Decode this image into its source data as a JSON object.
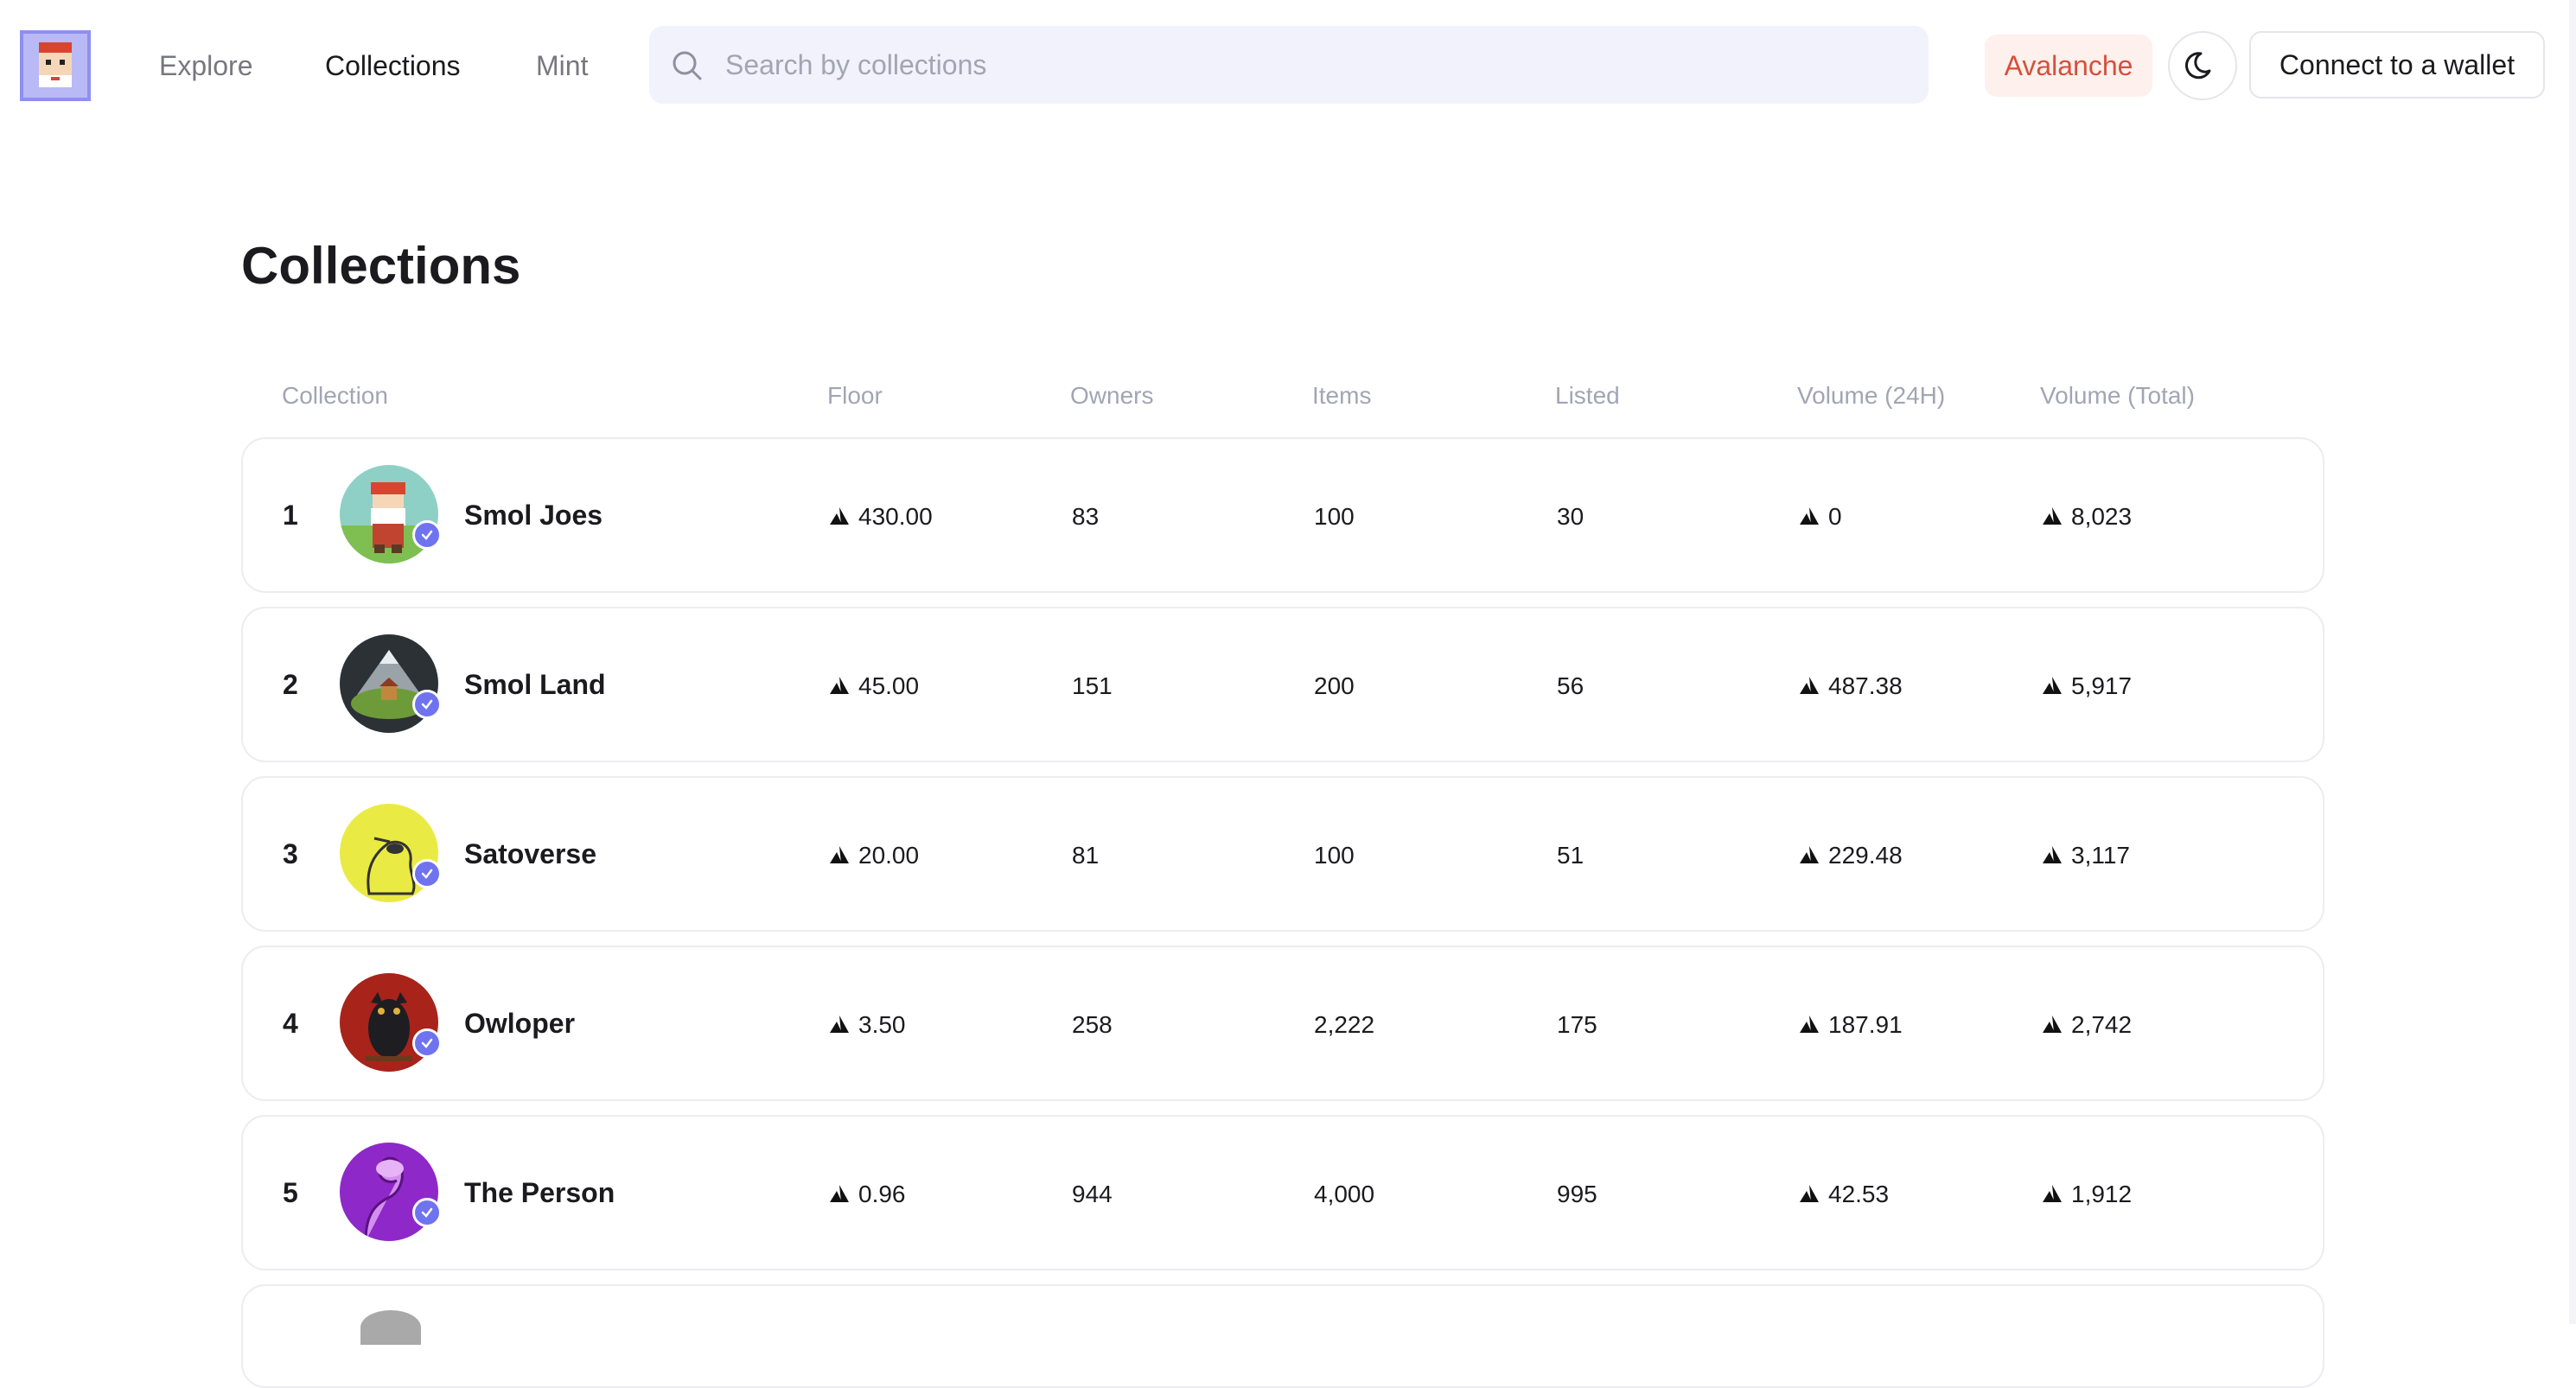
{
  "header": {
    "nav": [
      {
        "label": "Explore",
        "active": false
      },
      {
        "label": "Collections",
        "active": true
      },
      {
        "label": "Mint",
        "active": false
      }
    ],
    "search_placeholder": "Search by collections",
    "chain_label": "Avalanche",
    "connect_label": "Connect to a wallet",
    "icons": {
      "search": "search-icon",
      "theme": "moon-icon",
      "currency": "avax-icon",
      "verified": "verified-check-icon"
    },
    "colors": {
      "accent": "#6f73f0",
      "chain": "#d5503b"
    }
  },
  "page_title": "Collections",
  "table": {
    "columns": [
      "Collection",
      "Floor",
      "Owners",
      "Items",
      "Listed",
      "Volume (24H)",
      "Volume (Total)"
    ],
    "rows": [
      {
        "rank": "1",
        "name": "Smol Joes",
        "floor": "430.00",
        "owners": "83",
        "items": "100",
        "listed": "30",
        "vol24": "0",
        "voltot": "8,023"
      },
      {
        "rank": "2",
        "name": "Smol Land",
        "floor": "45.00",
        "owners": "151",
        "items": "200",
        "listed": "56",
        "vol24": "487.38",
        "voltot": "5,917"
      },
      {
        "rank": "3",
        "name": "Satoverse",
        "floor": "20.00",
        "owners": "81",
        "items": "100",
        "listed": "51",
        "vol24": "229.48",
        "voltot": "3,117"
      },
      {
        "rank": "4",
        "name": "Owloper",
        "floor": "3.50",
        "owners": "258",
        "items": "2,222",
        "listed": "175",
        "vol24": "187.91",
        "voltot": "2,742"
      },
      {
        "rank": "5",
        "name": "The Person",
        "floor": "0.96",
        "owners": "944",
        "items": "4,000",
        "listed": "995",
        "vol24": "42.53",
        "voltot": "1,912"
      }
    ]
  }
}
